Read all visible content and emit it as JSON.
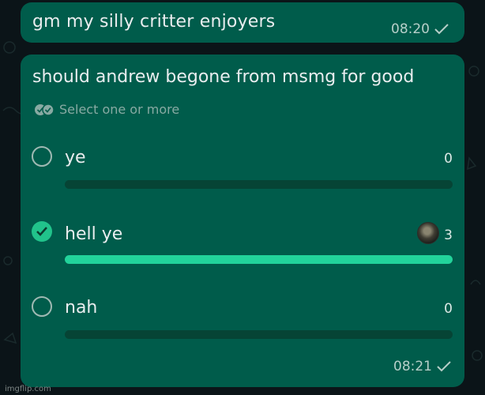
{
  "message": {
    "text": "gm my silly critter enjoyers",
    "time": "08:20"
  },
  "poll": {
    "question": "should andrew begone from msmg for good",
    "hint": "Select one or more",
    "options": [
      {
        "label": "ye",
        "count": "0",
        "checked": false,
        "fraction": 0
      },
      {
        "label": "hell ye",
        "count": "3",
        "checked": true,
        "fraction": 1
      },
      {
        "label": "nah",
        "count": "0",
        "checked": false,
        "fraction": 0
      }
    ],
    "time": "08:21"
  },
  "watermark": "imgflip.com",
  "colors": {
    "bubble": "#005c4b",
    "accent": "#21c38b",
    "track": "#064435",
    "background": "#0b1418"
  },
  "icons": {
    "sent": "single-check-icon",
    "hint": "double-check-icon",
    "selected": "check-circle-icon",
    "voter": "avatar"
  }
}
